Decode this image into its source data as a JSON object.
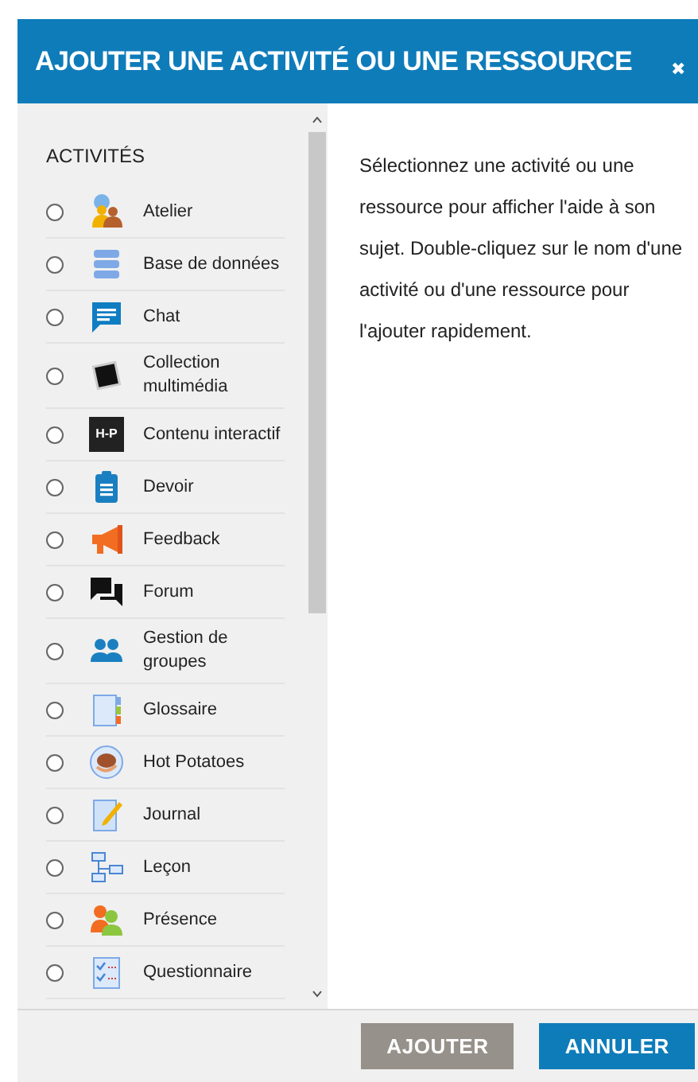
{
  "dialog": {
    "title": "AJOUTER UNE ACTIVITÉ OU UNE RESSOURCE",
    "close": "✖"
  },
  "section_heading": "ACTIVITÉS",
  "activities": [
    {
      "label": "Atelier",
      "selected": false
    },
    {
      "label": "Base de données",
      "selected": false
    },
    {
      "label": "Chat",
      "selected": false
    },
    {
      "label": "Collection multimédia",
      "selected": false
    },
    {
      "label": "Contenu interactif",
      "selected": false,
      "icon_text": "H-P"
    },
    {
      "label": "Devoir",
      "selected": false
    },
    {
      "label": "Feedback",
      "selected": false
    },
    {
      "label": "Forum",
      "selected": false
    },
    {
      "label": "Gestion de groupes",
      "selected": false
    },
    {
      "label": "Glossaire",
      "selected": false
    },
    {
      "label": "Hot Potatoes",
      "selected": false
    },
    {
      "label": "Journal",
      "selected": false
    },
    {
      "label": "Leçon",
      "selected": false
    },
    {
      "label": "Présence",
      "selected": false
    },
    {
      "label": "Questionnaire",
      "selected": false
    }
  ],
  "help_text": "Sélectionnez une activité ou une ressource pour afficher l'aide à son sujet. Double-cliquez sur le nom d'une activité ou d'une ressource pour l'ajouter rapidement.",
  "buttons": [
    {
      "label": "AJOUTER",
      "disabled": true
    },
    {
      "label": "ANNULER",
      "disabled": false
    }
  ]
}
